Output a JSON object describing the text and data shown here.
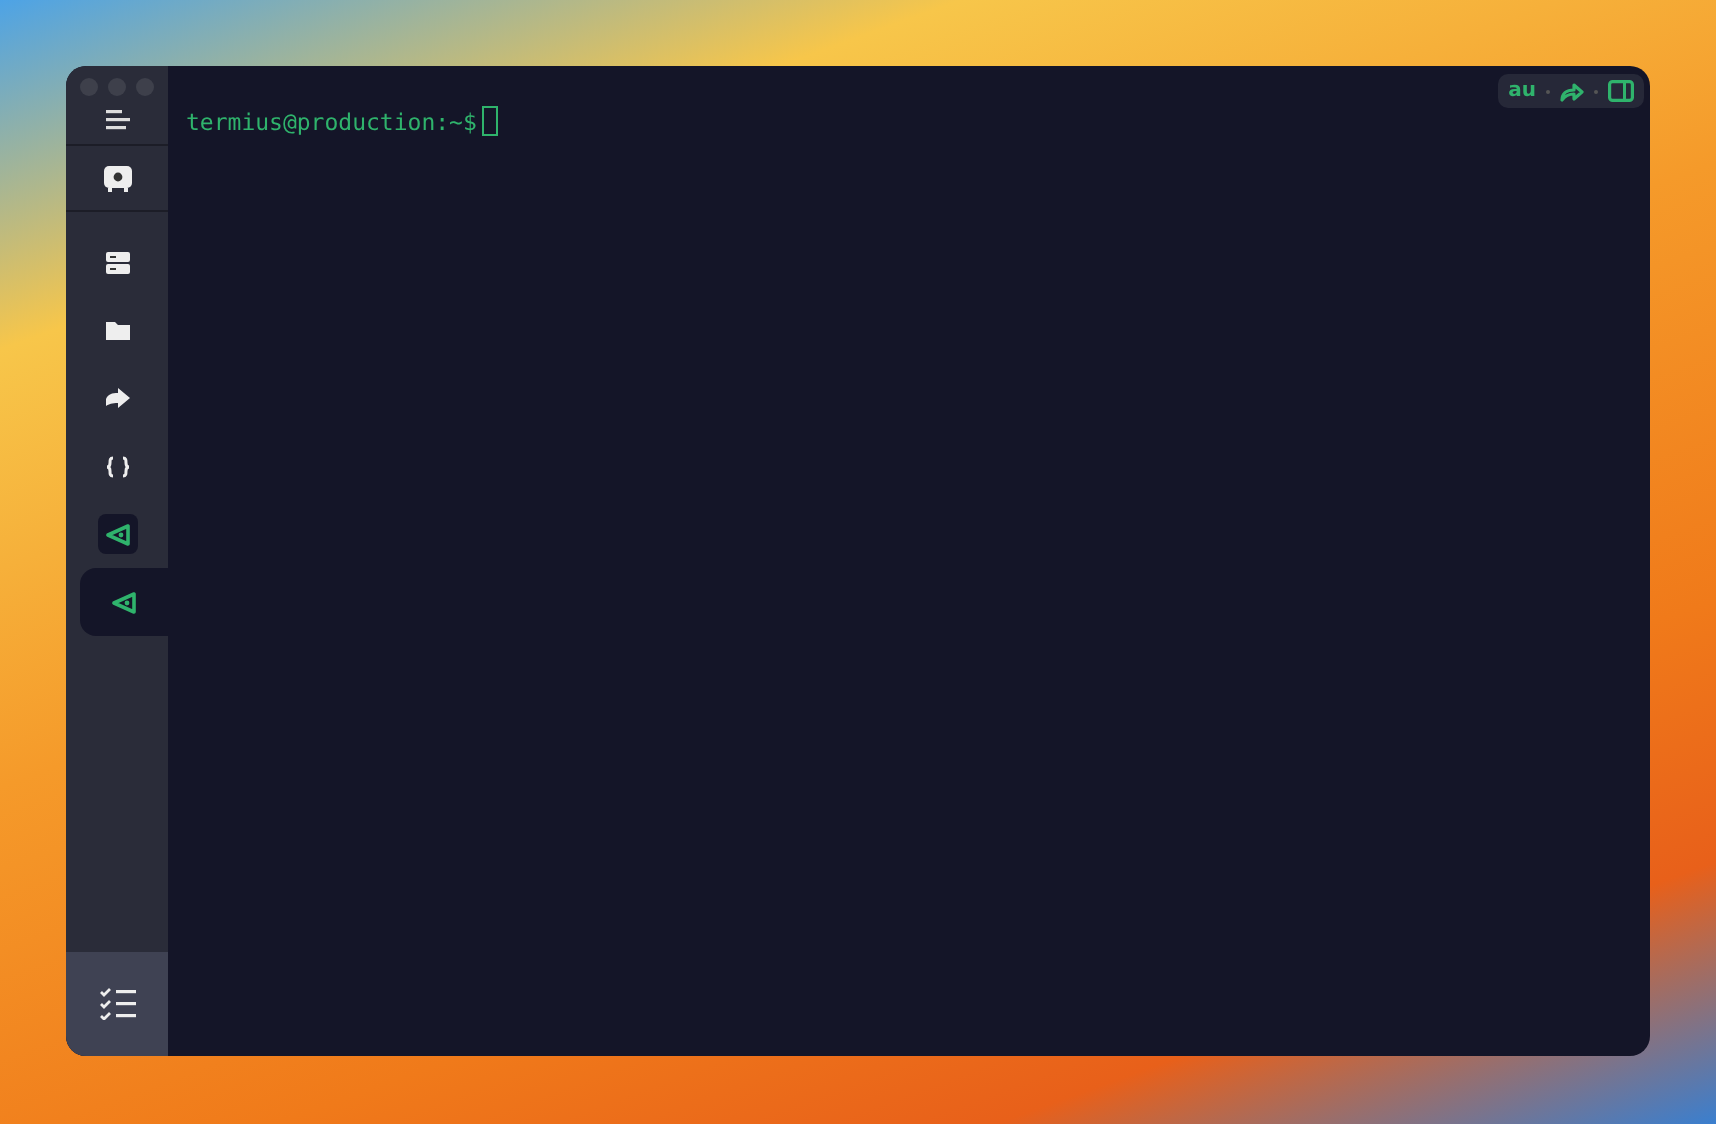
{
  "sidebar": {
    "nav": [
      {
        "kind": "hosts"
      },
      {
        "kind": "sftp"
      },
      {
        "kind": "forwarding"
      },
      {
        "kind": "snippets"
      }
    ],
    "tabs": [
      {
        "kind": "terminal",
        "selected": false
      },
      {
        "kind": "terminal",
        "selected": true
      }
    ]
  },
  "toolbar": {
    "autocomplete_label": "au"
  },
  "terminal": {
    "prompt": "termius@production:~$"
  }
}
